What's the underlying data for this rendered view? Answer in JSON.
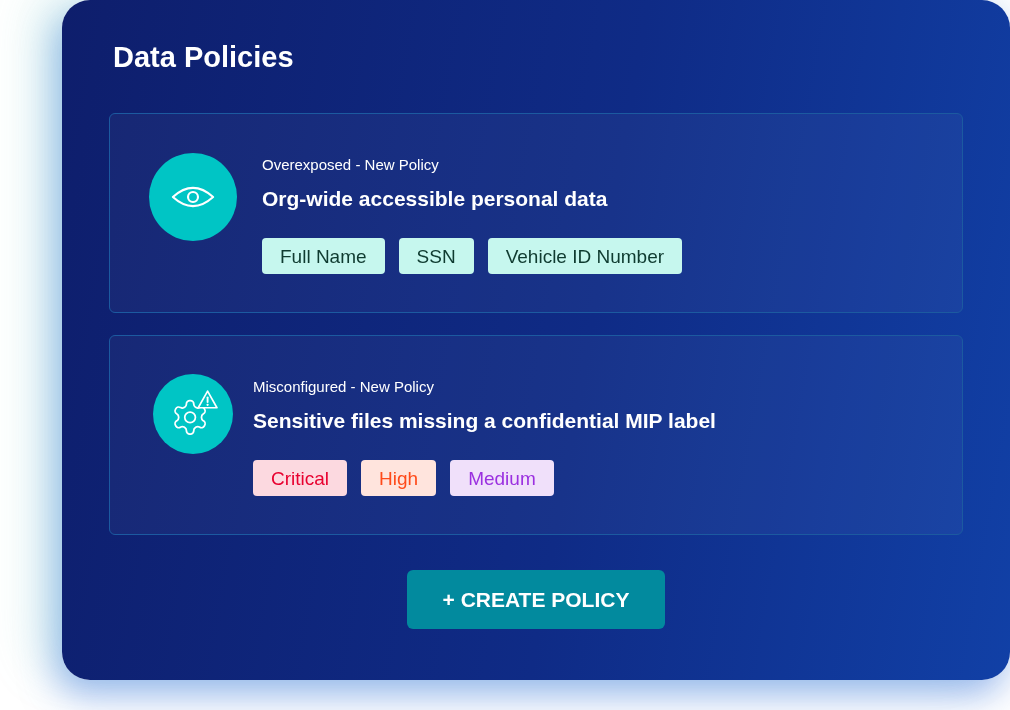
{
  "title": "Data Policies",
  "policies": [
    {
      "kind": "exposure",
      "category": "Overexposed - New Policy",
      "title": "Org-wide accessible personal data",
      "tags": [
        {
          "label": "Full Name"
        },
        {
          "label": "SSN"
        },
        {
          "label": "Vehicle ID Number"
        }
      ]
    },
    {
      "kind": "misconfiguration",
      "category": "Misconfigured - New Policy",
      "title": "Sensitive files missing a confidential MIP label",
      "tags": [
        {
          "label": "Critical",
          "color": "#e8002f"
        },
        {
          "label": "High",
          "color": "#ff4a1a"
        },
        {
          "label": "Medium",
          "color": "#9b30e0"
        }
      ]
    }
  ],
  "create_button": {
    "label": "+ CREATE POLICY"
  }
}
